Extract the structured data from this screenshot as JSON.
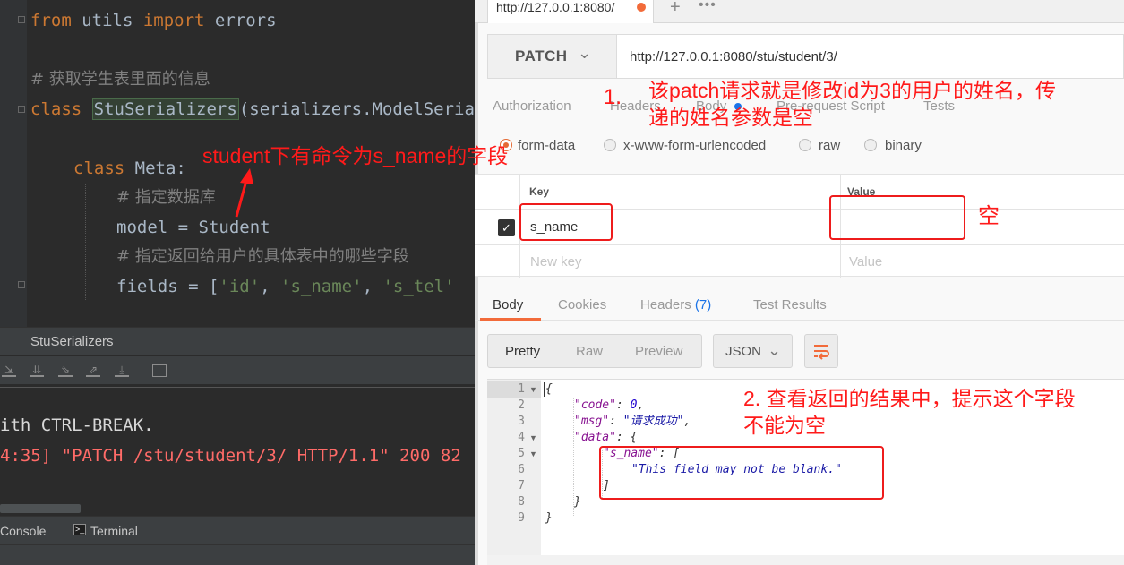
{
  "ide": {
    "code_lines": {
      "l1_kw": "from",
      "l1_mod": " utils ",
      "l1_kw2": "import",
      "l1_rest": " errors",
      "l2_comment": "# 获取学生表里面的信息",
      "l3_kw": "class",
      "l3_class": "StuSerializers",
      "l3_rest": "(serializers.ModelSeria",
      "l4_kw": "class",
      "l4_rest": " Meta:",
      "l5_comment": "# 指定数据库",
      "l6_text": "model = Student",
      "l7_comment": "# 指定返回给用户的具体表中的哪些字段",
      "l8_text": "fields = [",
      "l8_s1": "'id'",
      "l8_c1": ", ",
      "l8_s2": "'s_name'",
      "l8_c2": ", ",
      "l8_s3": "'s_tel'"
    },
    "breadcrumb": "StuSerializers",
    "run_output": {
      "line1": "ith CTRL-BREAK.",
      "line2": "4:35] \"PATCH /stu/student/3/ HTTP/1.1\" 200 82"
    },
    "bottom_tabs": {
      "console": "Console",
      "terminal": "Terminal"
    }
  },
  "postman": {
    "tab_title": "http://127.0.0.1:8080/",
    "tab_add": "+",
    "tab_more": "•••",
    "method": "PATCH",
    "url": "http://127.0.0.1:8080/stu/student/3/",
    "request_tabs": {
      "authorization": "Authorization",
      "headers": "Headers",
      "body": "Body",
      "prerequest": "Pre-request Script",
      "tests": "Tests"
    },
    "body_types": {
      "form_data": "form-data",
      "urlencoded": "x-www-form-urlencoded",
      "raw": "raw",
      "binary": "binary"
    },
    "kv": {
      "key_header": "Key",
      "value_header": "Value",
      "row_key": "s_name",
      "row_value": "",
      "new_key_placeholder": "New key",
      "new_value_placeholder": "Value"
    },
    "response_tabs": {
      "body": "Body",
      "cookies": "Cookies",
      "headers": "Headers",
      "headers_count": "(7)",
      "test_results": "Test Results"
    },
    "view": {
      "pretty": "Pretty",
      "raw": "Raw",
      "preview": "Preview",
      "format": "JSON"
    },
    "response_lines": {
      "l1": "{",
      "l2_key": "\"code\"",
      "l2_sep": ": ",
      "l2_val": "0",
      "l2_end": ",",
      "l3_key": "\"msg\"",
      "l3_sep": ": ",
      "l3_val": "\"请求成功\"",
      "l3_end": ",",
      "l4_key": "\"data\"",
      "l4_rest": ": {",
      "l5_key": "\"s_name\"",
      "l5_rest": ": [",
      "l6_val": "\"This field may not be blank.\"",
      "l7": "]",
      "l8": "}",
      "l9": "}"
    },
    "line_numbers": [
      "1",
      "2",
      "3",
      "4",
      "5",
      "6",
      "7",
      "8",
      "9"
    ]
  },
  "annotations": {
    "student_field": "student下有命令为s_name的字段",
    "step1_num": "1.",
    "step1_text": "该patch请求就是修改id为3的用户的姓名，传\n递的姓名参数是空",
    "empty": "空",
    "step2_text": "2. 查看返回的结果中，提示这个字段\n不能为空"
  },
  "colors": {
    "annotation_red": "#ff1a1a",
    "postman_orange": "#f26b3a",
    "ide_keyword": "#cc7832"
  }
}
